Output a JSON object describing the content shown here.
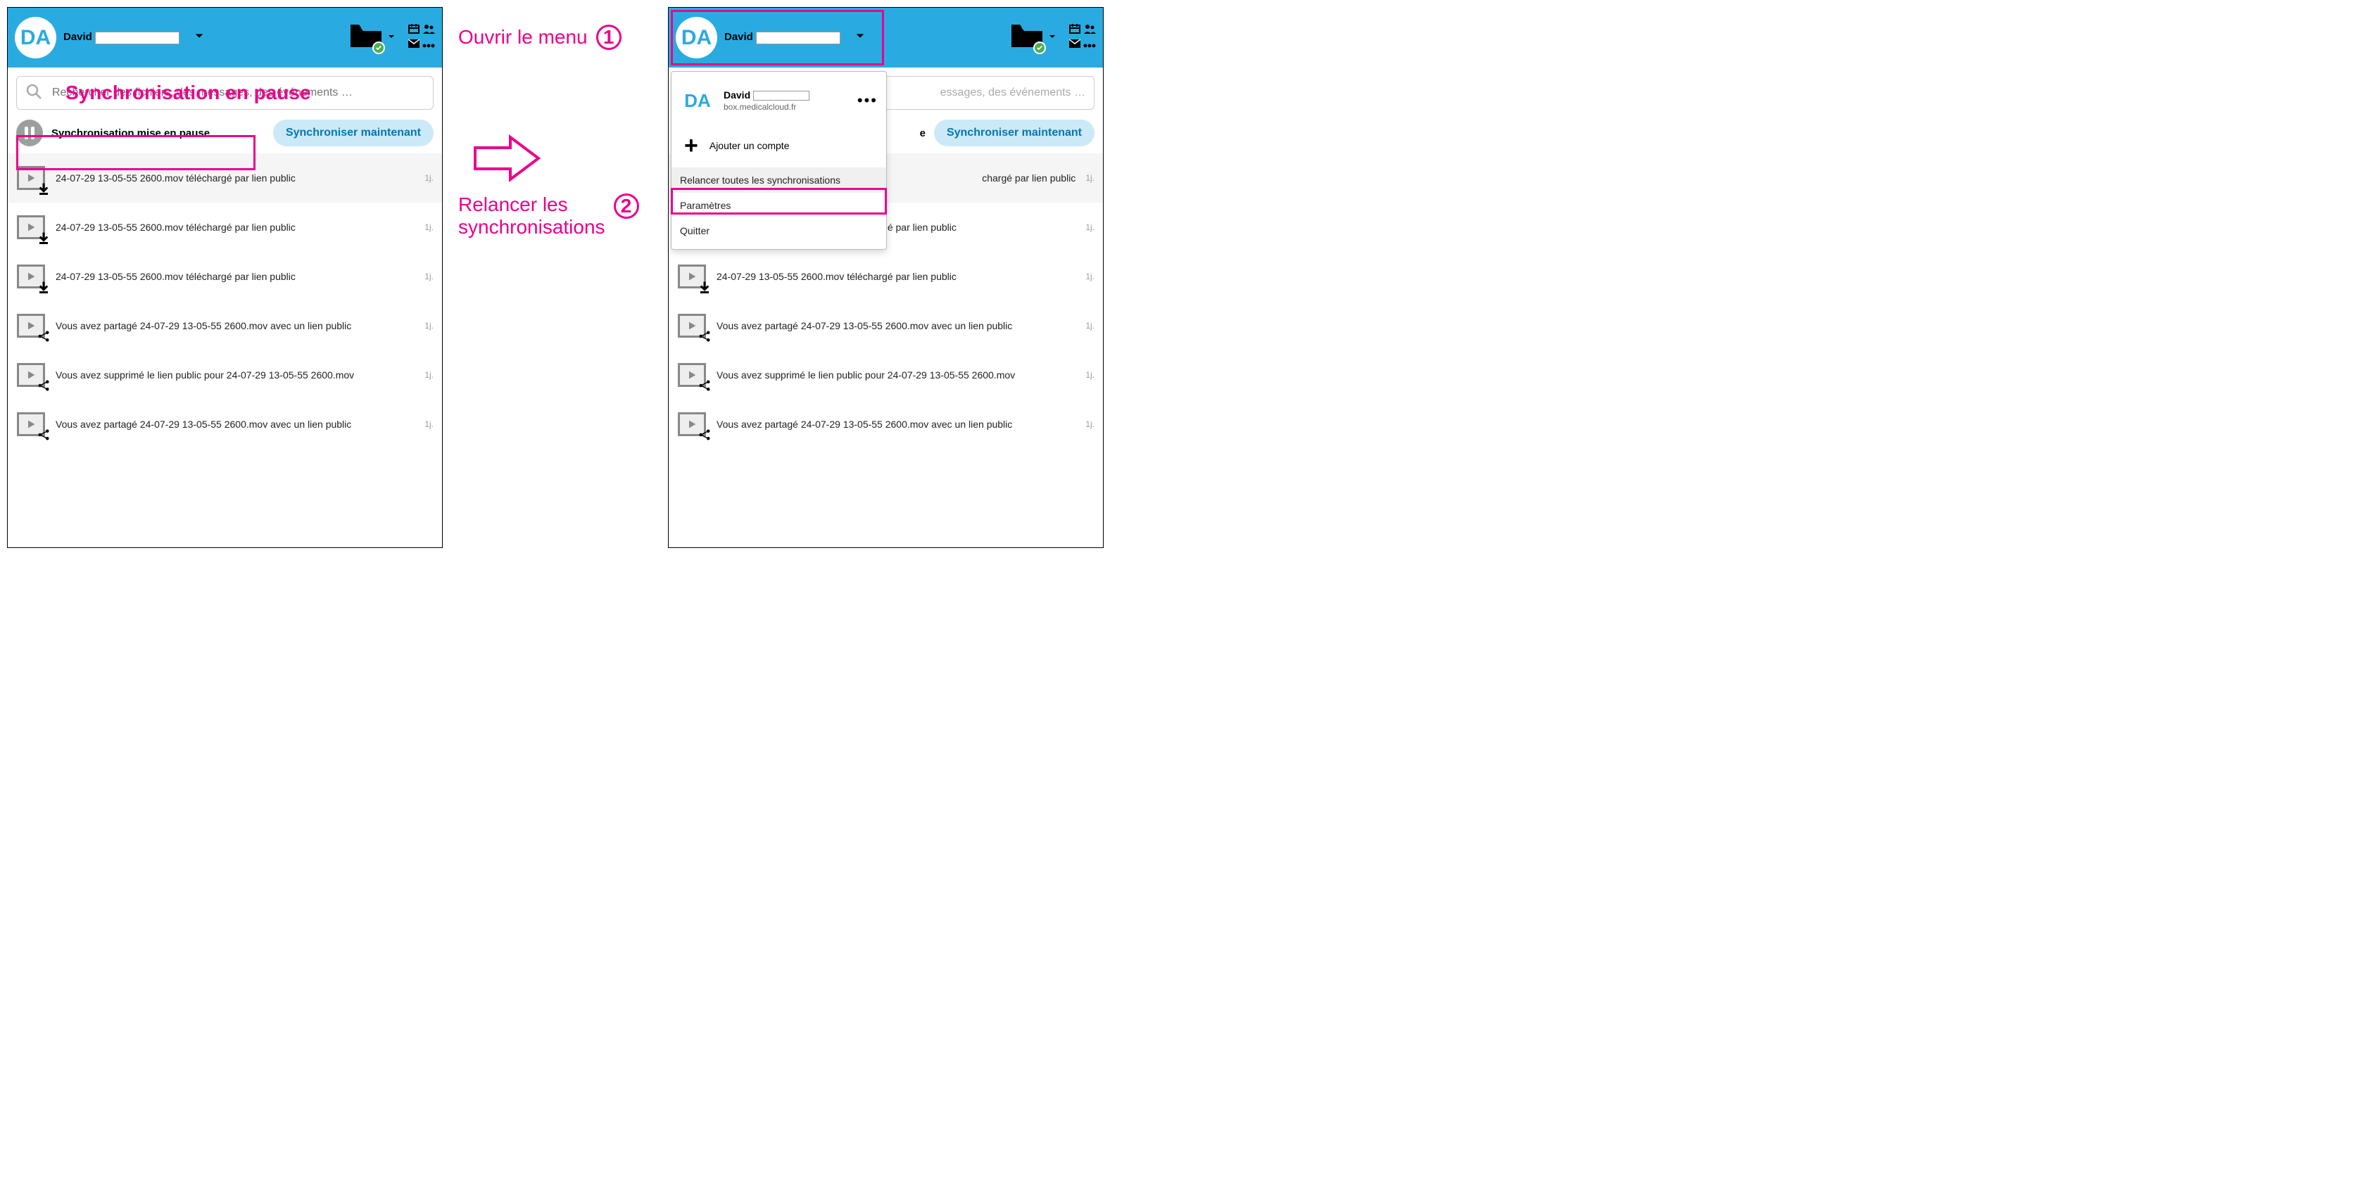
{
  "user": {
    "initials": "DA",
    "name": "David",
    "server": "box.medicalcloud.fr"
  },
  "search": {
    "placeholder": "Rechercher des fichiers, des messages, des événements …",
    "placeholder_truncated": "essages, des événements …"
  },
  "sync": {
    "status_label": "Synchronisation mise en pause",
    "button_label": "Synchroniser maintenant",
    "status_trunc": "e"
  },
  "activity": [
    {
      "text": "24-07-29 13-05-55 2600.mov téléchargé par lien public",
      "age": "1j.",
      "overlay": "download"
    },
    {
      "text": "24-07-29 13-05-55 2600.mov téléchargé par lien public",
      "age": "1j.",
      "overlay": "download"
    },
    {
      "text": "24-07-29 13-05-55 2600.mov téléchargé par lien public",
      "age": "1j.",
      "overlay": "download"
    },
    {
      "text": "Vous avez partagé 24-07-29 13-05-55 2600.mov avec un lien public",
      "age": "1j.",
      "overlay": "share"
    },
    {
      "text": "Vous avez supprimé le lien public pour 24-07-29 13-05-55 2600.mov",
      "age": "1j.",
      "overlay": "share"
    },
    {
      "text": "Vous avez partagé 24-07-29 13-05-55 2600.mov avec un lien public",
      "age": "1j.",
      "overlay": "share"
    }
  ],
  "activity_right_trunc": "chargé par lien public",
  "menu": {
    "add_account": "Ajouter un compte",
    "restart_sync": "Relancer toutes les synchronisations",
    "settings": "Paramètres",
    "quit": "Quitter"
  },
  "annotations": {
    "step1": "Ouvrir le menu",
    "step2_line1": "Relancer les",
    "step2_line2": "synchronisations",
    "overlay_search": "Synchronisation en pause",
    "num1": "1",
    "num2": "2"
  }
}
